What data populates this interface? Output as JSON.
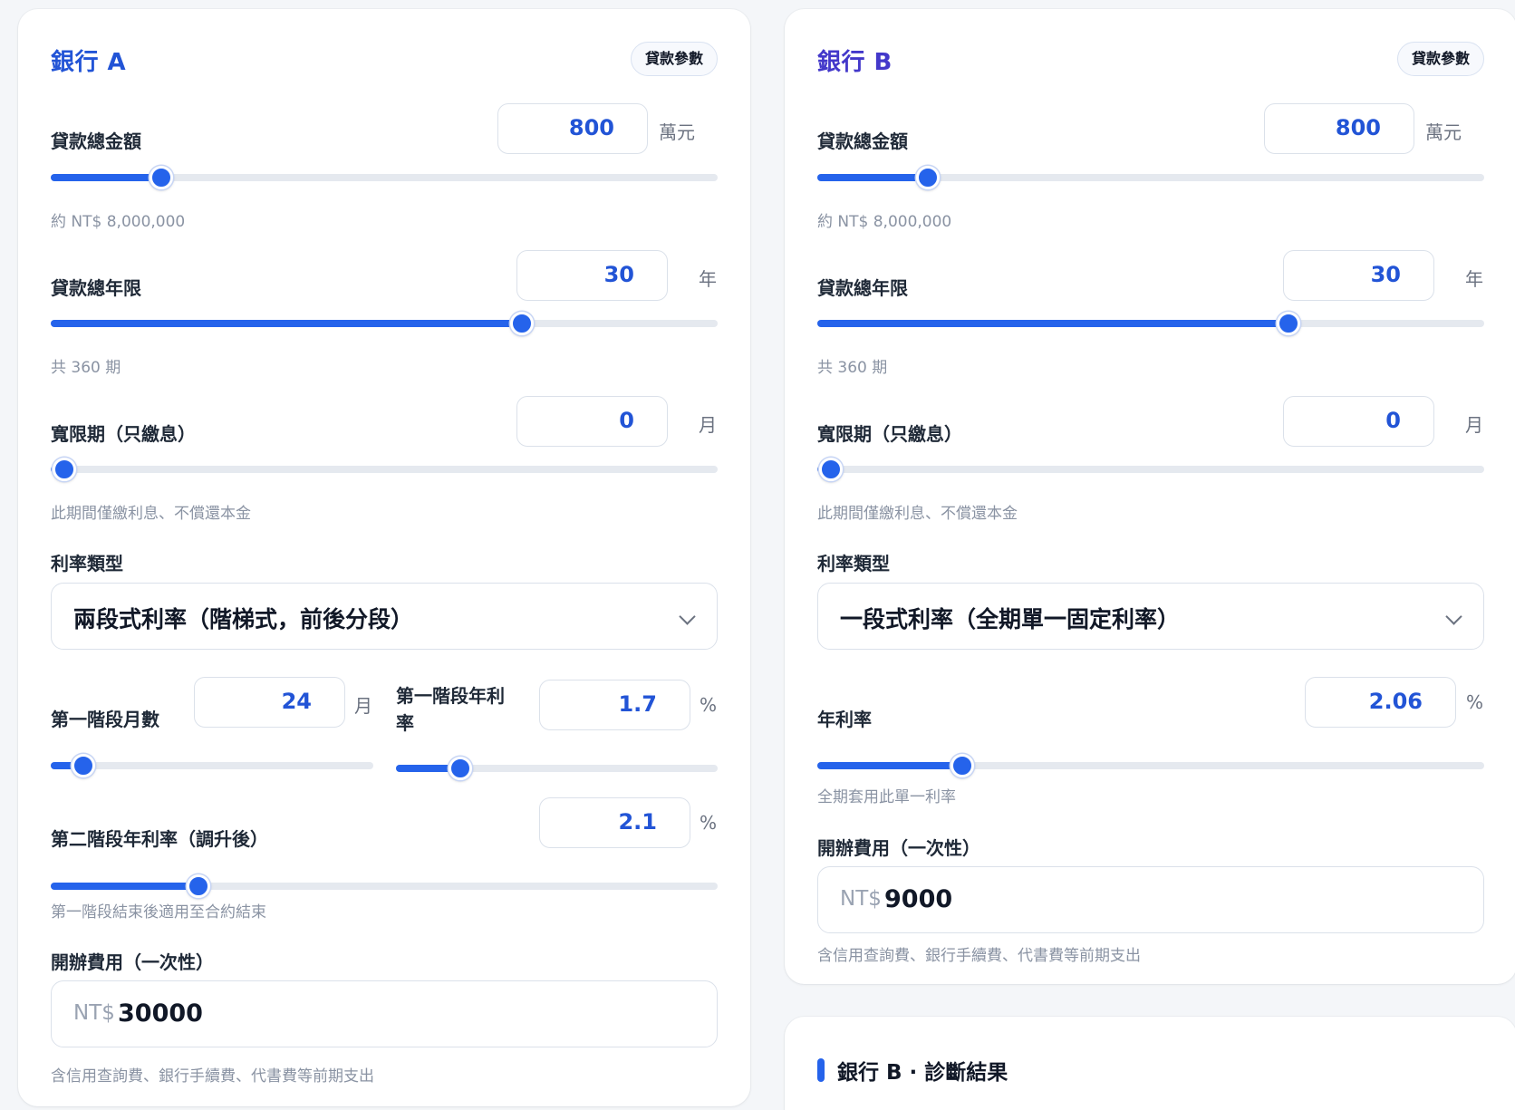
{
  "theme": {
    "accent": "#2563eb",
    "value_color": "#2254d6",
    "title_a": "#2254d6",
    "title_b": "#4338ca"
  },
  "bank_a": {
    "title": "銀行 A",
    "badge": "貸款參數",
    "loan_amount": {
      "label": "貸款總金額",
      "value": "800",
      "unit": "萬元",
      "hint": "約 NT$ 8,000,000",
      "slider_fraction": 0.166
    },
    "loan_years": {
      "label": "貸款總年限",
      "value": "30",
      "unit": "年",
      "hint": "共 360 期",
      "slider_fraction": 0.706
    },
    "grace": {
      "label": "寬限期（只繳息）",
      "value": "0",
      "unit": "月",
      "hint": "此期間僅繳利息、不償還本金",
      "slider_fraction": 0.02
    },
    "rate_type": {
      "label": "利率類型",
      "selected": "兩段式利率（階梯式，前後分段）"
    },
    "stage1_months": {
      "label": "第一階段月數",
      "value": "24",
      "unit": "月",
      "slider_fraction": 0.1
    },
    "stage1_rate": {
      "label_line1": "第一階段年利",
      "label_line2": "率",
      "value": "1.7",
      "unit": "%",
      "slider_fraction": 0.2
    },
    "stage2_rate": {
      "label": "第二階段年利率（調升後）",
      "value": "2.1",
      "unit": "%",
      "hint": "第一階段結束後適用至合約結束",
      "slider_fraction": 0.222
    },
    "fee": {
      "label": "開辦費用（一次性）",
      "prefix": "NT$",
      "value": "30000",
      "hint": "含信用查詢費、銀行手續費、代書費等前期支出"
    }
  },
  "bank_b": {
    "title": "銀行 B",
    "badge": "貸款參數",
    "loan_amount": {
      "label": "貸款總金額",
      "value": "800",
      "unit": "萬元",
      "hint": "約 NT$ 8,000,000",
      "slider_fraction": 0.166
    },
    "loan_years": {
      "label": "貸款總年限",
      "value": "30",
      "unit": "年",
      "hint": "共 360 期",
      "slider_fraction": 0.706
    },
    "grace": {
      "label": "寬限期（只繳息）",
      "value": "0",
      "unit": "月",
      "hint": "此期間僅繳利息、不償還本金",
      "slider_fraction": 0.02
    },
    "rate_type": {
      "label": "利率類型",
      "selected": "一段式利率（全期單一固定利率）"
    },
    "annual_rate": {
      "label": "年利率",
      "value": "2.06",
      "unit": "%",
      "hint": "全期套用此單一利率",
      "slider_fraction": 0.218
    },
    "fee": {
      "label": "開辦費用（一次性）",
      "prefix": "NT$",
      "value": "9000",
      "hint": "含信用查詢費、銀行手續費、代書費等前期支出"
    }
  },
  "diagnosis": {
    "title": "銀行 B · 診斷結果"
  }
}
